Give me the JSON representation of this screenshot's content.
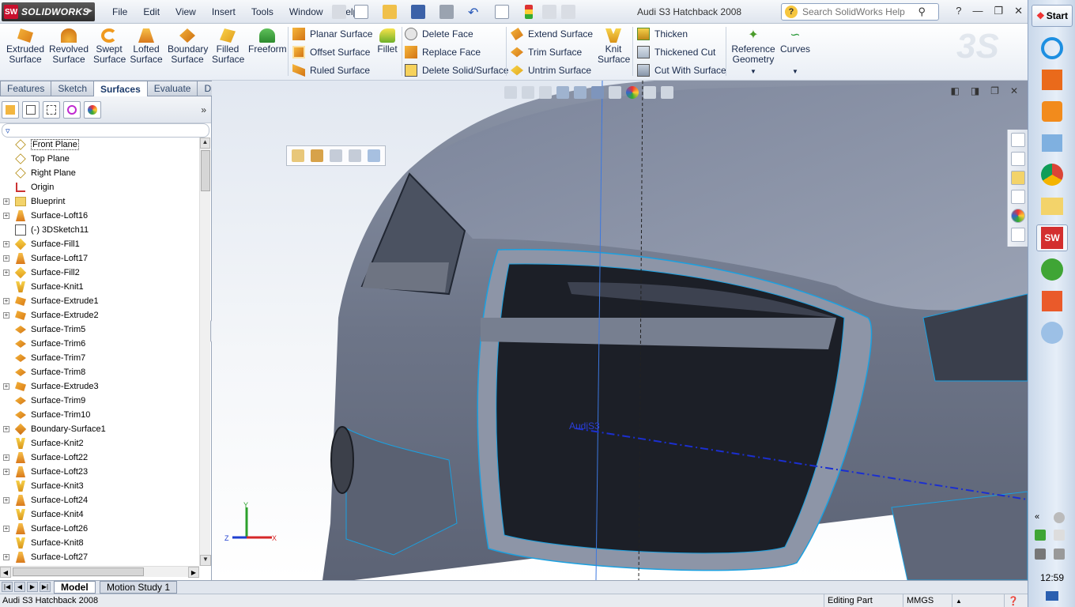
{
  "app": {
    "logo_text": "SOLIDWORKS",
    "document_title": "Audi S3 Hatchback 2008"
  },
  "menu": [
    "File",
    "Edit",
    "View",
    "Insert",
    "Tools",
    "Window",
    "Help"
  ],
  "search": {
    "placeholder": "Search SolidWorks Help"
  },
  "commands": {
    "extruded_surface": "Extruded Surface",
    "revolved_surface": "Revolved Surface",
    "swept_surface": "Swept Surface",
    "lofted_surface": "Lofted Surface",
    "boundary_surface": "Boundary Surface",
    "filled_surface": "Filled Surface",
    "freeform": "Freeform",
    "planar_surface": "Planar Surface",
    "offset_surface": "Offset Surface",
    "ruled_surface": "Ruled Surface",
    "fillet": "Fillet",
    "delete_face": "Delete Face",
    "replace_face": "Replace Face",
    "delete_solid_surface": "Delete Solid/Surface",
    "extend_surface": "Extend Surface",
    "trim_surface": "Trim Surface",
    "untrim_surface": "Untrim Surface",
    "knit_surface": "Knit Surface",
    "thicken": "Thicken",
    "thickened_cut": "Thickened Cut",
    "cut_with_surface": "Cut With Surface",
    "reference_geometry": "Reference Geometry",
    "curves": "Curves"
  },
  "cm_tabs": [
    {
      "label": "Features",
      "active": false
    },
    {
      "label": "Sketch",
      "active": false
    },
    {
      "label": "Surfaces",
      "active": true
    },
    {
      "label": "Evaluate",
      "active": false
    },
    {
      "label": "DimXpert",
      "active": false
    }
  ],
  "tree": [
    {
      "label": "Front Plane",
      "icon": "plane-icon",
      "expandable": false,
      "selected": true
    },
    {
      "label": "Top Plane",
      "icon": "plane-icon",
      "expandable": false
    },
    {
      "label": "Right Plane",
      "icon": "plane-icon",
      "expandable": false
    },
    {
      "label": "Origin",
      "icon": "origin-icon",
      "expandable": false
    },
    {
      "label": "Blueprint",
      "icon": "folder-icon",
      "expandable": true
    },
    {
      "label": "Surface-Loft16",
      "icon": "loft-icon",
      "expandable": true
    },
    {
      "label": "(-) 3DSketch11",
      "icon": "sketch3d-icon",
      "expandable": false
    },
    {
      "label": "Surface-Fill1",
      "icon": "fill-icon",
      "expandable": true
    },
    {
      "label": "Surface-Loft17",
      "icon": "loft-icon",
      "expandable": true
    },
    {
      "label": "Surface-Fill2",
      "icon": "fill-icon",
      "expandable": true
    },
    {
      "label": "Surface-Knit1",
      "icon": "knit-icon",
      "expandable": false
    },
    {
      "label": "Surface-Extrude1",
      "icon": "extrude-icon",
      "expandable": true
    },
    {
      "label": "Surface-Extrude2",
      "icon": "extrude-icon",
      "expandable": true
    },
    {
      "label": "Surface-Trim5",
      "icon": "trim-icon",
      "expandable": false
    },
    {
      "label": "Surface-Trim6",
      "icon": "trim-icon",
      "expandable": false
    },
    {
      "label": "Surface-Trim7",
      "icon": "trim-icon",
      "expandable": false
    },
    {
      "label": "Surface-Trim8",
      "icon": "trim-icon",
      "expandable": false
    },
    {
      "label": "Surface-Extrude3",
      "icon": "extrude-icon",
      "expandable": true
    },
    {
      "label": "Surface-Trim9",
      "icon": "trim-icon",
      "expandable": false
    },
    {
      "label": "Surface-Trim10",
      "icon": "trim-icon",
      "expandable": false
    },
    {
      "label": "Boundary-Surface1",
      "icon": "boundary-icon",
      "expandable": true
    },
    {
      "label": "Surface-Knit2",
      "icon": "knit-icon",
      "expandable": false
    },
    {
      "label": "Surface-Loft22",
      "icon": "loft-icon",
      "expandable": true
    },
    {
      "label": "Surface-Loft23",
      "icon": "loft-icon",
      "expandable": true
    },
    {
      "label": "Surface-Knit3",
      "icon": "knit-icon",
      "expandable": false
    },
    {
      "label": "Surface-Loft24",
      "icon": "loft-icon",
      "expandable": true
    },
    {
      "label": "Surface-Knit4",
      "icon": "knit-icon",
      "expandable": false
    },
    {
      "label": "Surface-Loft26",
      "icon": "loft-icon",
      "expandable": true
    },
    {
      "label": "Surface-Knit8",
      "icon": "knit-icon",
      "expandable": false
    },
    {
      "label": "Surface-Loft27",
      "icon": "loft-icon",
      "expandable": true
    }
  ],
  "viewport": {
    "sketch_label": "AudiS3"
  },
  "bottom_tabs": [
    {
      "label": "Model",
      "active": true
    },
    {
      "label": "Motion Study 1",
      "active": false
    }
  ],
  "status": {
    "left_text": "Audi S3 Hatchback 2008",
    "mode": "Editing Part",
    "units": "MMGS"
  },
  "taskbar": {
    "start_label": "Start",
    "clock": "12:59"
  },
  "colors": {
    "accent": "#1c3b6b",
    "body_surface": "#6b7384",
    "edge_blue": "#1aa0e0"
  }
}
